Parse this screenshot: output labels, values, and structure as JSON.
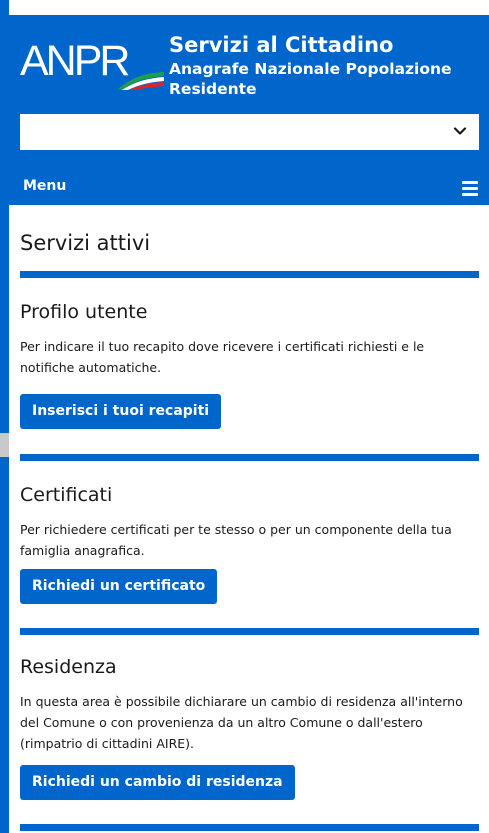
{
  "header": {
    "logo_text": "ANPR",
    "title": "Servizi al Cittadino",
    "subtitle": "Anagrafe Nazionale Popolazione Residente",
    "select_value": "",
    "menu_label": "Menu"
  },
  "main": {
    "title": "Servizi attivi",
    "services": [
      {
        "title": "Profilo utente",
        "description": "Per indicare il tuo recapito dove ricevere i certificati richiesti e le notifiche automatiche.",
        "button": "Inserisci i tuoi recapiti"
      },
      {
        "title": "Certificati",
        "description": "Per richiedere certificati per te stesso o per un componente della tua famiglia anagrafica.",
        "button": "Richiedi un certificato"
      },
      {
        "title": "Residenza",
        "description": "In questa area è possibile dichiarare un cambio di residenza all'interno del Comune o con provenienza da un altro Comune o dall'estero (rimpatrio di cittadini AIRE).",
        "button": "Richiedi un cambio di residenza"
      }
    ]
  },
  "icons": [
    "anpr-flag-logo",
    "chevron-down-icon",
    "hamburger-menu-icon"
  ],
  "colors": {
    "primary": "#0066cc",
    "text": "#1a1a1a",
    "background": "#ffffff"
  }
}
